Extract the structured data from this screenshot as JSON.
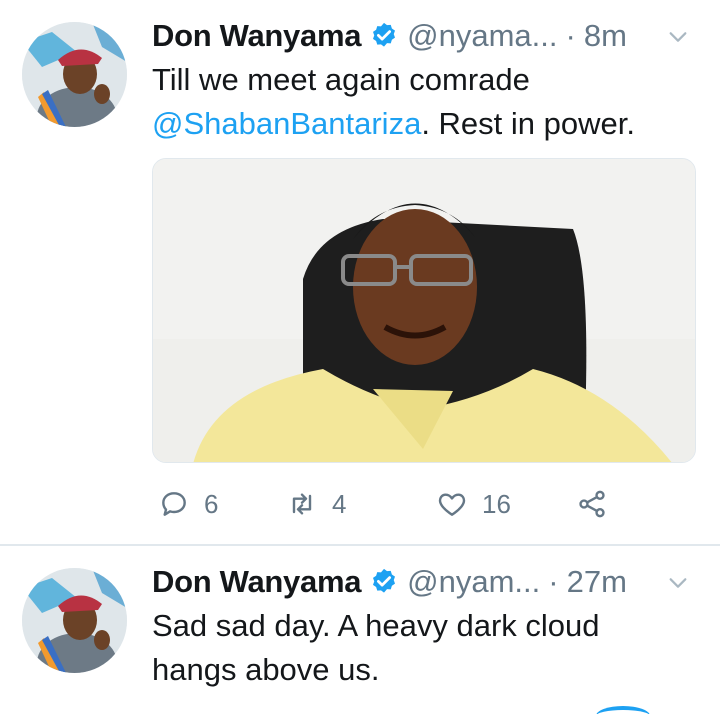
{
  "tweets": [
    {
      "author_name": "Don Wanyama",
      "handle": "@nyama...",
      "separator": "·",
      "time": "8m",
      "text_before": "Till we meet again comrade",
      "mention": "@ShabanBantariza",
      "text_after": ". Rest in power.",
      "actions": {
        "reply_count": "6",
        "retweet_count": "4",
        "like_count": "16"
      }
    },
    {
      "author_name": "Don Wanyama",
      "handle": "@nyam...",
      "separator": "·",
      "time": "27m",
      "text": "Sad sad day. A heavy dark cloud hangs above us."
    }
  ],
  "colors": {
    "accent": "#1da1f2",
    "muted": "#657786",
    "text": "#14171a",
    "divider": "#e1e8ed"
  },
  "icons": {
    "verified": "verified-badge-icon",
    "caret": "chevron-down-icon",
    "reply": "reply-icon",
    "retweet": "retweet-icon",
    "like": "heart-icon",
    "share": "share-icon"
  }
}
